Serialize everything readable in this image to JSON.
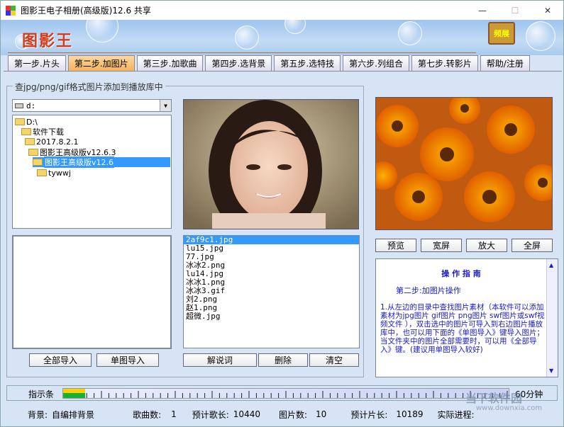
{
  "window": {
    "title": "图影王电子相册(高级版)12.6 共享",
    "min": "—",
    "max": "☐",
    "close": "✕"
  },
  "banner": {
    "logo": "图影王",
    "film_label": "频展"
  },
  "tabs": [
    {
      "label": "第一步.片头"
    },
    {
      "label": "第二步.加图片",
      "active": true
    },
    {
      "label": "第三步.加歌曲"
    },
    {
      "label": "第四步.选背景"
    },
    {
      "label": "第五步.选特技"
    },
    {
      "label": "第六步.列组合"
    },
    {
      "label": "第七步.转影片"
    },
    {
      "label": "帮助/注册"
    }
  ],
  "groupbox": {
    "legend": "查jpg/png/gif格式图片添加到播放库中"
  },
  "drive": {
    "value": "d:"
  },
  "tree": [
    {
      "label": "D:\\"
    },
    {
      "label": "软件下载"
    },
    {
      "label": "2017.8.2.1"
    },
    {
      "label": "图影王高级版v12.6.3"
    },
    {
      "label": "图影王高级版v12.6",
      "selected": true
    },
    {
      "label": "tywwj"
    }
  ],
  "left_buttons": {
    "import_all": "全部导入",
    "import_single": "单图导入"
  },
  "files": [
    "2af9c1.jpg",
    "lu15.jpg",
    "77.jpg",
    "冰冰2.png",
    "lu14.jpg",
    "冰冰1.png",
    "冰冰3.gif",
    "刘2.png",
    "赵1.png",
    "超微.jpg"
  ],
  "selected_file": "2af9c1.jpg",
  "file_buttons": {
    "caption": "解说词",
    "delete": "删除",
    "clear": "清空"
  },
  "preview_buttons": {
    "preview": "预览",
    "wide": "宽屏",
    "zoom": "放大",
    "fullscreen": "全屏"
  },
  "guide": {
    "title": "操 作 指 南",
    "subtitle": "第二步:加图片操作",
    "body": "1.从左边的目录中查找图片素材（本软件可以添加素材为jpg图片 gif图片 png图片 swf图片或swf视频文件 ），双击选中的图片可导入到右边图片播放库中，也可以用下面的《单图导入》键导入图片；当文件夹中的图片全部需要时，可以用《全部导入》键。(建议用单图导入较好)"
  },
  "indicator": {
    "label": "指示条",
    "right": "60分钟",
    "fill_fraction": 0.05
  },
  "status": {
    "background_label": "背景:",
    "background_value": "自编排背景",
    "songs_label": "歌曲数:",
    "songs_value": "1",
    "song_len_label": "预计歌长:",
    "song_len_value": "10440",
    "pics_label": "图片数:",
    "pics_value": "10",
    "film_len_label": "预计片长:",
    "film_len_value": "10189",
    "progress_label": "实际进程:"
  },
  "watermark": {
    "text": "当下软件园",
    "url": "www.downxia.com"
  },
  "colors": {
    "accent": "#3399ff",
    "guide_text": "#1a1ac8",
    "logo": "#d13a1a",
    "tab_active": "#f5b35a"
  }
}
